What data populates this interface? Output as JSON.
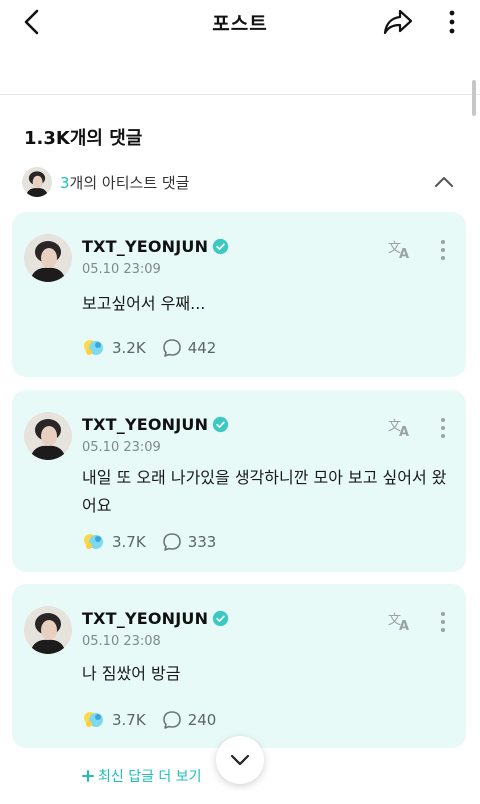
{
  "header": {
    "title": "포스트"
  },
  "comments_section": {
    "count_label": "1.3K개의 댓글",
    "artist_count": "3",
    "artist_label_suffix": "개의 아티스트 댓글"
  },
  "comments": [
    {
      "author": "TXT_YEONJUN",
      "date": "05.10 23:09",
      "text": "보고싶어서 우째...",
      "likes": "3.2K",
      "replies": "442"
    },
    {
      "author": "TXT_YEONJUN",
      "date": "05.10 23:09",
      "text": "내일 또 오래 나가있을 생각하니깐 모아 보고 싶어서 왔어요",
      "likes": "3.7K",
      "replies": "333"
    },
    {
      "author": "TXT_YEONJUN",
      "date": "05.10 23:08",
      "text": "나 짐쌌어 방금",
      "likes": "3.7K",
      "replies": "240"
    }
  ],
  "footer": {
    "more_replies_label": "최신 답글 더 보기"
  },
  "colors": {
    "accent": "#1ec0b9",
    "card_background": "#e7faf7",
    "verified_badge": "#3cc9c2"
  },
  "icons": [
    "back-icon",
    "share-icon",
    "more-vertical-icon",
    "chevron-up-icon",
    "verified-icon",
    "translate-icon",
    "like-icon",
    "reply-bubble-icon",
    "chevron-down-icon",
    "plus-icon"
  ]
}
